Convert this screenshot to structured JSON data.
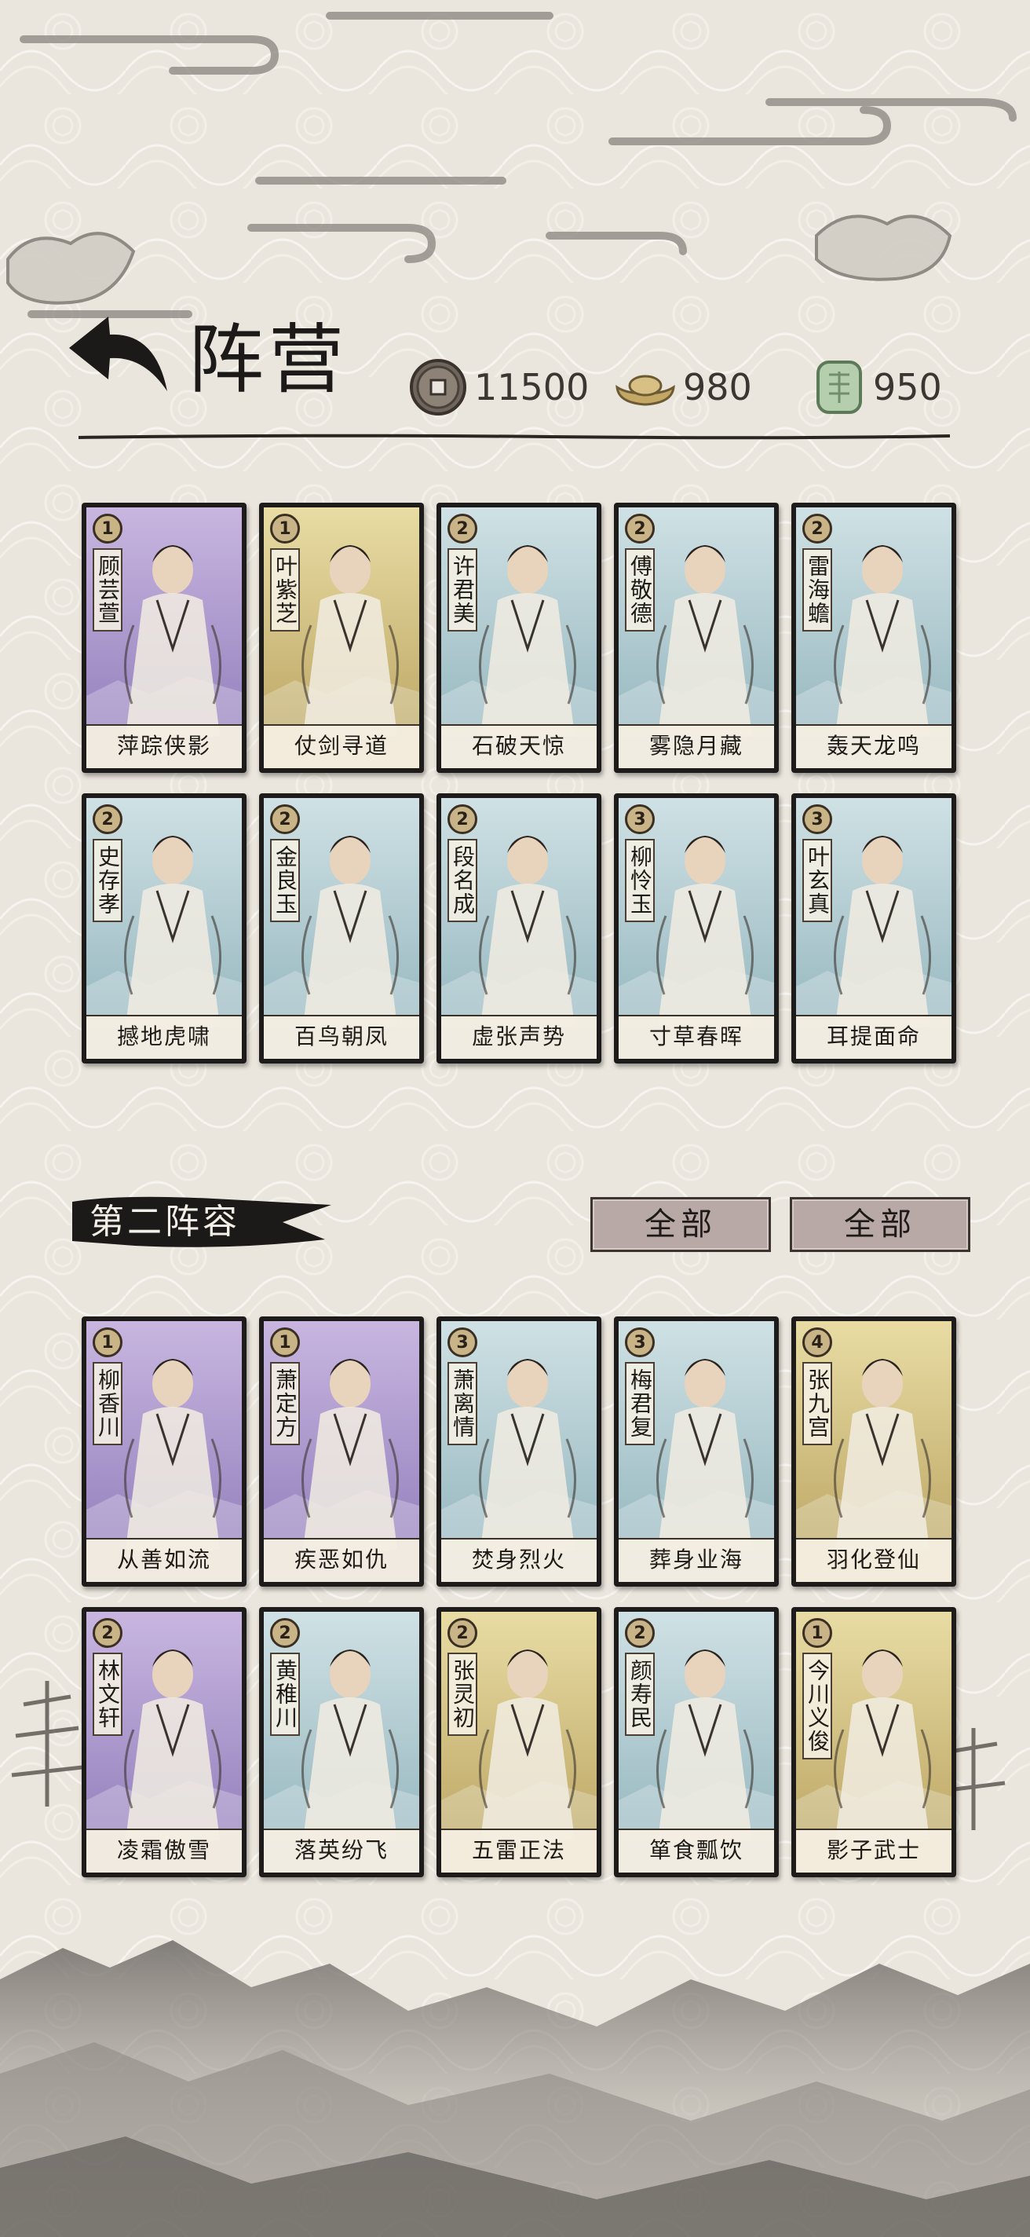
{
  "header": {
    "title": "阵营",
    "currencies": [
      {
        "icon": "copper-coin-icon",
        "value": "11500"
      },
      {
        "icon": "gold-ingot-icon",
        "value": "980"
      },
      {
        "icon": "jade-token-icon",
        "value": "950"
      }
    ]
  },
  "team1": {
    "cards": [
      {
        "name": "顾芸萱",
        "level": "1",
        "skill": "萍踪侠影",
        "bg": "purple"
      },
      {
        "name": "叶紫芝",
        "level": "1",
        "skill": "仗剑寻道",
        "bg": "gold"
      },
      {
        "name": "许君美",
        "level": "2",
        "skill": "石破天惊",
        "bg": "blue"
      },
      {
        "name": "傅敬德",
        "level": "2",
        "skill": "雾隐月藏",
        "bg": "blue"
      },
      {
        "name": "雷海蟾",
        "level": "2",
        "skill": "轰天龙鸣",
        "bg": "blue"
      },
      {
        "name": "史存孝",
        "level": "2",
        "skill": "撼地虎啸",
        "bg": "blue"
      },
      {
        "name": "金良玉",
        "level": "2",
        "skill": "百鸟朝凤",
        "bg": "blue"
      },
      {
        "name": "段名成",
        "level": "2",
        "skill": "虚张声势",
        "bg": "blue"
      },
      {
        "name": "柳怜玉",
        "level": "3",
        "skill": "寸草春晖",
        "bg": "blue"
      },
      {
        "name": "叶玄真",
        "level": "3",
        "skill": "耳提面命",
        "bg": "blue"
      }
    ]
  },
  "team2": {
    "label": "第二阵容",
    "filter1": "全部",
    "filter2": "全部",
    "cards": [
      {
        "name": "柳香川",
        "level": "1",
        "skill": "从善如流",
        "bg": "purple"
      },
      {
        "name": "萧定方",
        "level": "1",
        "skill": "疾恶如仇",
        "bg": "purple"
      },
      {
        "name": "萧离情",
        "level": "3",
        "skill": "焚身烈火",
        "bg": "blue"
      },
      {
        "name": "梅君复",
        "level": "3",
        "skill": "葬身业海",
        "bg": "blue"
      },
      {
        "name": "张九宫",
        "level": "4",
        "skill": "羽化登仙",
        "bg": "gold"
      },
      {
        "name": "林文轩",
        "level": "2",
        "skill": "凌霜傲雪",
        "bg": "purple"
      },
      {
        "name": "黄稚川",
        "level": "2",
        "skill": "落英纷飞",
        "bg": "blue"
      },
      {
        "name": "张灵初",
        "level": "2",
        "skill": "五雷正法",
        "bg": "gold"
      },
      {
        "name": "颜寿民",
        "level": "2",
        "skill": "箪食瓢饮",
        "bg": "blue"
      },
      {
        "name": "今川义俊",
        "level": "1",
        "skill": "影子武士",
        "bg": "gold"
      }
    ]
  },
  "colors": {
    "purple": [
      "#c8b6e0",
      "#8d79b8"
    ],
    "gold": [
      "#e8dca4",
      "#b8a15e"
    ],
    "blue": [
      "#cfe1e4",
      "#8fb2bb"
    ],
    "paper": "#ebe6dd"
  }
}
